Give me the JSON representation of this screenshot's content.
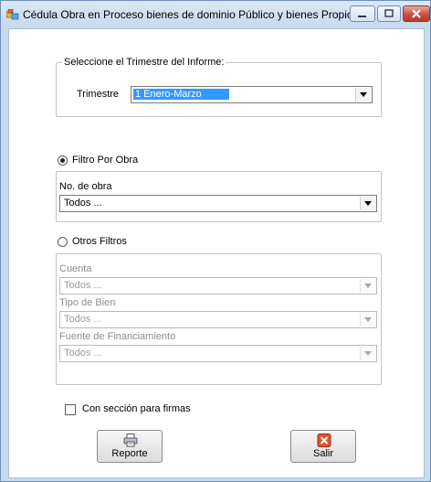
{
  "window": {
    "title": "Cédula Obra en Proceso bienes de dominio Público y bienes Propios",
    "controls": [
      "minimize",
      "maximize",
      "close"
    ]
  },
  "trimestre_group": {
    "legend": "Seleccione el Trimestre del Informe:",
    "label": "Trimestre",
    "selected": "1 Enero-Marzo"
  },
  "filtro_obra": {
    "radio_label": "Filtro Por Obra",
    "checked": true,
    "field_label": "No. de obra",
    "value": "Todos  ..."
  },
  "otros_filtros": {
    "radio_label": "Otros Filtros",
    "checked": false,
    "fields": [
      {
        "label": "Cuenta",
        "value": "Todos  ..."
      },
      {
        "label": "Tipo de Bien",
        "value": "Todos  ..."
      },
      {
        "label": "Fuente de Financiamiento",
        "value": "Todos  ..."
      }
    ]
  },
  "firmas": {
    "label": "Con sección para firmas",
    "checked": false
  },
  "buttons": {
    "reporte": "Reporte",
    "salir": "Salir"
  },
  "colors": {
    "selection": "#3399ff",
    "close_button": "#c9503d",
    "salir_icon": "#e0552b"
  },
  "icons": {
    "app": "app-icon",
    "reporte": "printer-icon",
    "salir": "exit-x-icon"
  }
}
